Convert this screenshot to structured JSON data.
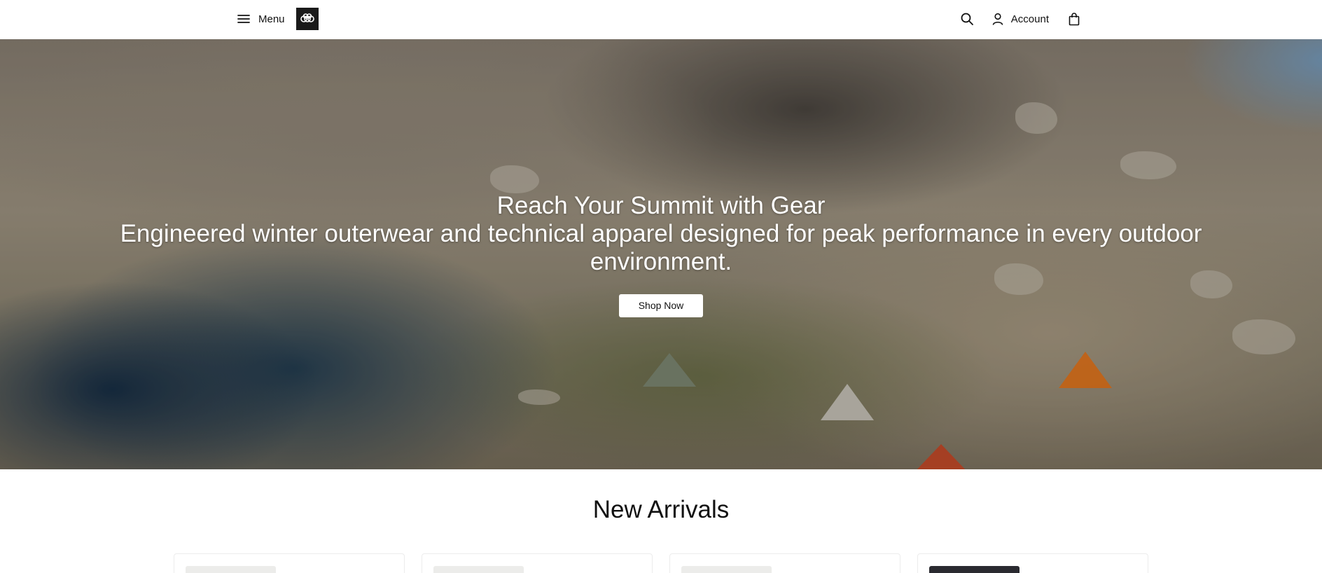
{
  "header": {
    "menu_label": "Menu",
    "logo_alt": "686",
    "account_label": "Account",
    "icons": {
      "menu": "menu-icon",
      "search": "search-icon",
      "account": "user-icon",
      "bag": "bag-icon"
    }
  },
  "hero": {
    "title": "Reach Your Summit with Gear",
    "subtitle": "Engineered winter outerwear and technical apparel designed for peak performance in every outdoor environment.",
    "cta_label": "Shop Now"
  },
  "new_arrivals": {
    "title": "New Arrivals",
    "product_count_visible": 4
  },
  "colors": {
    "accent": "#1a1a1a",
    "background": "#ffffff",
    "hero_text": "#ffffff"
  }
}
